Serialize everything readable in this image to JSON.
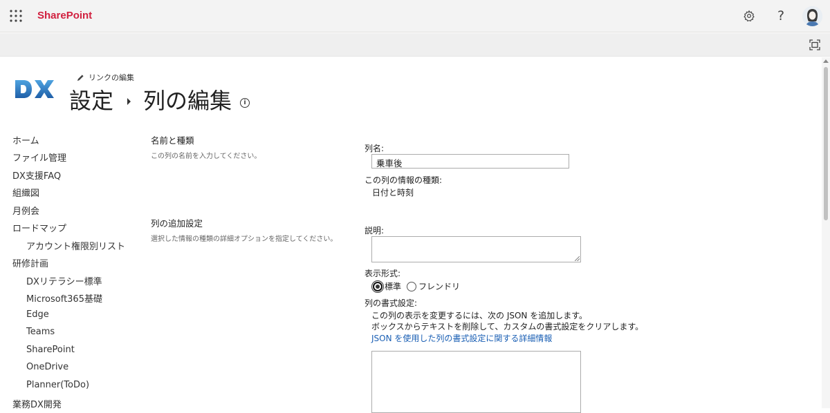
{
  "suitebar": {
    "brand": "SharePoint",
    "settings_icon": "gear-icon",
    "help_glyph": "?",
    "help_icon": "question-icon",
    "avatar_icon": "user-avatar"
  },
  "cmdbar": {
    "focus_icon": "focus-mode-icon"
  },
  "header": {
    "edit_link_label": "リンクの編集",
    "breadcrumb_root": "設定",
    "page_title": "列の編集",
    "info_glyph": "i"
  },
  "leftnav": {
    "items": [
      {
        "label": "ホーム",
        "level": 1
      },
      {
        "label": "ファイル管理",
        "level": 1
      },
      {
        "label": "DX支援FAQ",
        "level": 1
      },
      {
        "label": "組織図",
        "level": 1
      },
      {
        "label": "月例会",
        "level": 1
      },
      {
        "label": "ロードマップ",
        "level": 1
      },
      {
        "label": "アカウント権限別リスト",
        "level": 2
      },
      {
        "label": "研修計画",
        "level": 1
      },
      {
        "label": "DXリテラシー標準",
        "level": 2
      },
      {
        "label": "Microsoft365基礎",
        "level": 2
      },
      {
        "label": "Edge",
        "level": 2
      },
      {
        "label": "Teams",
        "level": 2
      },
      {
        "label": "SharePoint",
        "level": 2
      },
      {
        "label": "OneDrive",
        "level": 2
      },
      {
        "label": "Planner(ToDo)",
        "level": 2
      },
      {
        "label": "業務DX開発",
        "level": 1
      }
    ]
  },
  "section_name": {
    "title": "名前と種類",
    "description": "この列の名前を入力してください。",
    "column_name_label": "列名:",
    "column_name_value": "乗車後",
    "type_label": "この列の情報の種類:",
    "type_value": "日付と時刻"
  },
  "section_additional": {
    "title": "列の追加設定",
    "description": "選択した情報の種類の詳細オプションを指定してください。",
    "description_label": "説明:",
    "display_format_label": "表示形式:",
    "format_options": [
      "標準",
      "フレンドリ"
    ],
    "format_selected": "標準",
    "column_formatting_label": "列の書式設定:",
    "json_line1": "この列の表示を変更するには、次の JSON を追加します。",
    "json_line2": "ボックスからテキストを削除して、カスタムの書式設定をクリアします。",
    "json_link": "JSON を使用した列の書式設定に関する詳細情報"
  },
  "colors": {
    "brand": "#d1203f",
    "link": "#1a5fb4",
    "logo_blue": "#2f7fc8"
  }
}
